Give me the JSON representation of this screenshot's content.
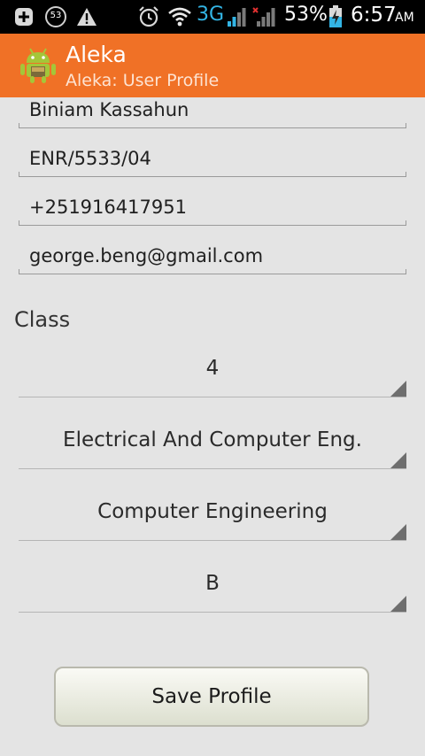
{
  "status_bar": {
    "notification_count": "53",
    "network": "3G",
    "battery": "53%",
    "time": "6:57",
    "ampm": "AM"
  },
  "action_bar": {
    "title": "Aleka",
    "subtitle": "Aleka: User Profile"
  },
  "form": {
    "name": "Biniam Kassahun",
    "id_number": "ENR/5533/04",
    "phone": "+251916417951",
    "email": "george.beng@gmail.com",
    "class_label": "Class",
    "year": "4",
    "department": "Electrical And Computer Eng.",
    "stream": "Computer Engineering",
    "section": "B",
    "save_label": "Save Profile"
  },
  "colors": {
    "action_bar": "#f07126",
    "background": "#e4e4e4"
  }
}
